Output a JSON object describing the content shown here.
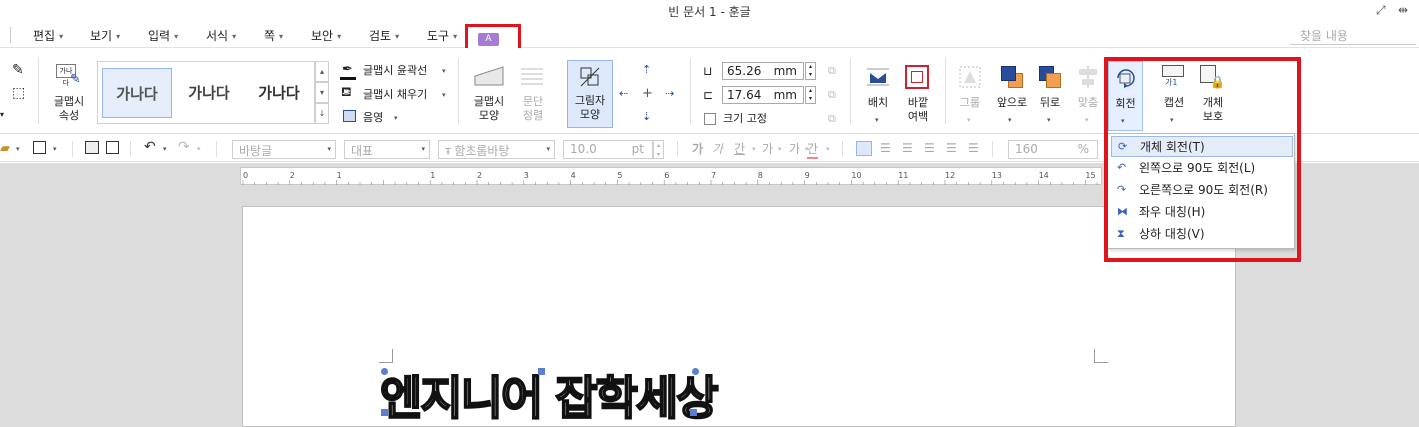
{
  "window": {
    "title": "빈 문서 1 - 훈글"
  },
  "menu": {
    "items": [
      {
        "label": "편집"
      },
      {
        "label": "보기"
      },
      {
        "label": "입력"
      },
      {
        "label": "서식"
      },
      {
        "label": "쪽"
      },
      {
        "label": "보안"
      },
      {
        "label": "검토"
      },
      {
        "label": "도구"
      }
    ],
    "find_placeholder": "찾을 내용"
  },
  "ribbon": {
    "wordart_props": "글맵시\n속성",
    "gallery": [
      "가나다",
      "가나다",
      "가나다"
    ],
    "outline_label": "글맵시 윤곽선",
    "fill_label": "글맵시 채우기",
    "shadow_label": "음영",
    "shape_label": "글맵시\n모양",
    "para_align_label": "문단\n정렬",
    "shadow_shape_label": "그림자\n모양",
    "width_value": "65.26",
    "height_value": "17.64",
    "unit": "mm",
    "fix_size_label": "크기 고정",
    "arrange_label": "배치",
    "outer_margin_label": "바깥\n여백",
    "group_label": "그룹",
    "front_label": "앞으로",
    "back_label": "뒤로",
    "align_label": "맞춤",
    "rotate_label": "회전",
    "caption_label": "캡션",
    "protect_label": "개체\n보호",
    "caption_icon_text": "가1"
  },
  "format_bar": {
    "style": "바탕글",
    "lang": "대표",
    "font": "함초롬바탕",
    "size": "10.0",
    "size_unit": "pt",
    "line_spacing": "160",
    "line_unit": "%"
  },
  "ruler": {
    "labels": [
      "0",
      "2",
      "1",
      "",
      "1",
      "2",
      "3",
      "4",
      "5",
      "6",
      "7",
      "8",
      "9",
      "10",
      "11",
      "12",
      "13",
      "14",
      "15"
    ]
  },
  "document": {
    "wordart_text": "엔지니어 잡학세상"
  },
  "rotate_menu": {
    "items": [
      {
        "label": "개체 회전(T)",
        "icon": "rotate-object-icon"
      },
      {
        "label": "왼쪽으로 90도 회전(L)",
        "icon": "rotate-left-icon"
      },
      {
        "label": "오른쪽으로 90도 회전(R)",
        "icon": "rotate-right-icon"
      },
      {
        "label": "좌우 대칭(H)",
        "icon": "flip-horizontal-icon"
      },
      {
        "label": "상하 대칭(V)",
        "icon": "flip-vertical-icon"
      }
    ]
  },
  "colors": {
    "highlight_red": "#e0141d",
    "accent_blue": "#3a64b8",
    "purple_icon": "#a57bd6"
  }
}
